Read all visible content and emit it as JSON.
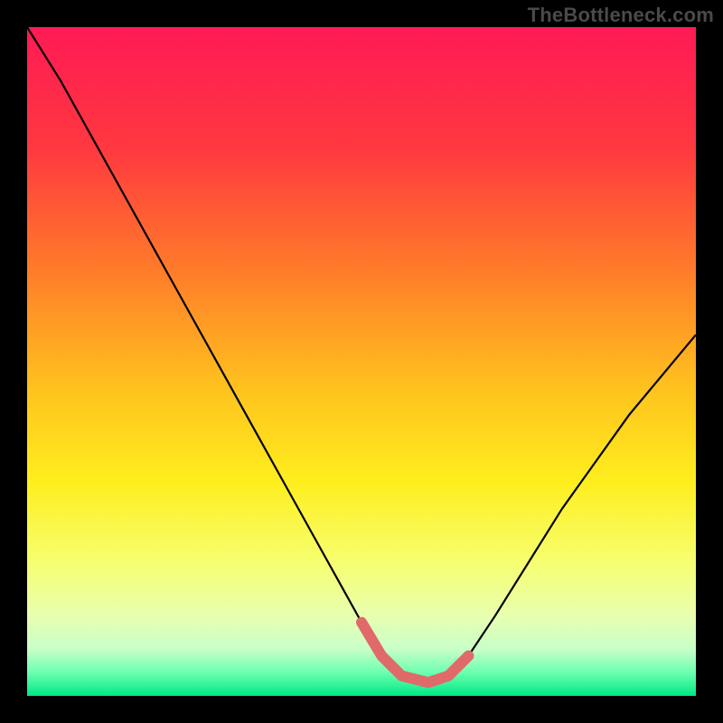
{
  "attribution": "TheBottleneck.com",
  "chart_data": {
    "type": "line",
    "title": "",
    "xlabel": "",
    "ylabel": "",
    "xlim": [
      0,
      100
    ],
    "ylim": [
      0,
      100
    ],
    "gradient_stops": [
      {
        "offset": 0.0,
        "color": "#ff1a55"
      },
      {
        "offset": 0.18,
        "color": "#ff3840"
      },
      {
        "offset": 0.36,
        "color": "#ff7a2a"
      },
      {
        "offset": 0.54,
        "color": "#ffc21e"
      },
      {
        "offset": 0.68,
        "color": "#ffee1e"
      },
      {
        "offset": 0.8,
        "color": "#f6ff70"
      },
      {
        "offset": 0.88,
        "color": "#e8ffb0"
      },
      {
        "offset": 0.93,
        "color": "#c8ffc8"
      },
      {
        "offset": 0.965,
        "color": "#6cffb0"
      },
      {
        "offset": 1.0,
        "color": "#00e884"
      }
    ],
    "series": [
      {
        "name": "bottleneck-curve",
        "color": "#000000",
        "x": [
          0,
          5,
          10,
          15,
          20,
          25,
          30,
          35,
          40,
          45,
          50,
          53,
          56,
          60,
          63,
          66,
          70,
          75,
          80,
          85,
          90,
          95,
          100
        ],
        "y": [
          100,
          92,
          83,
          74,
          65,
          56,
          47,
          38,
          29,
          20,
          11,
          6,
          3,
          2,
          3,
          6,
          12,
          20,
          28,
          35,
          42,
          48,
          54
        ]
      },
      {
        "name": "valley-highlight",
        "color": "#e06a6a",
        "x": [
          50,
          53,
          56,
          60,
          63,
          66
        ],
        "y": [
          11,
          6,
          3,
          2,
          3,
          6
        ]
      }
    ]
  }
}
